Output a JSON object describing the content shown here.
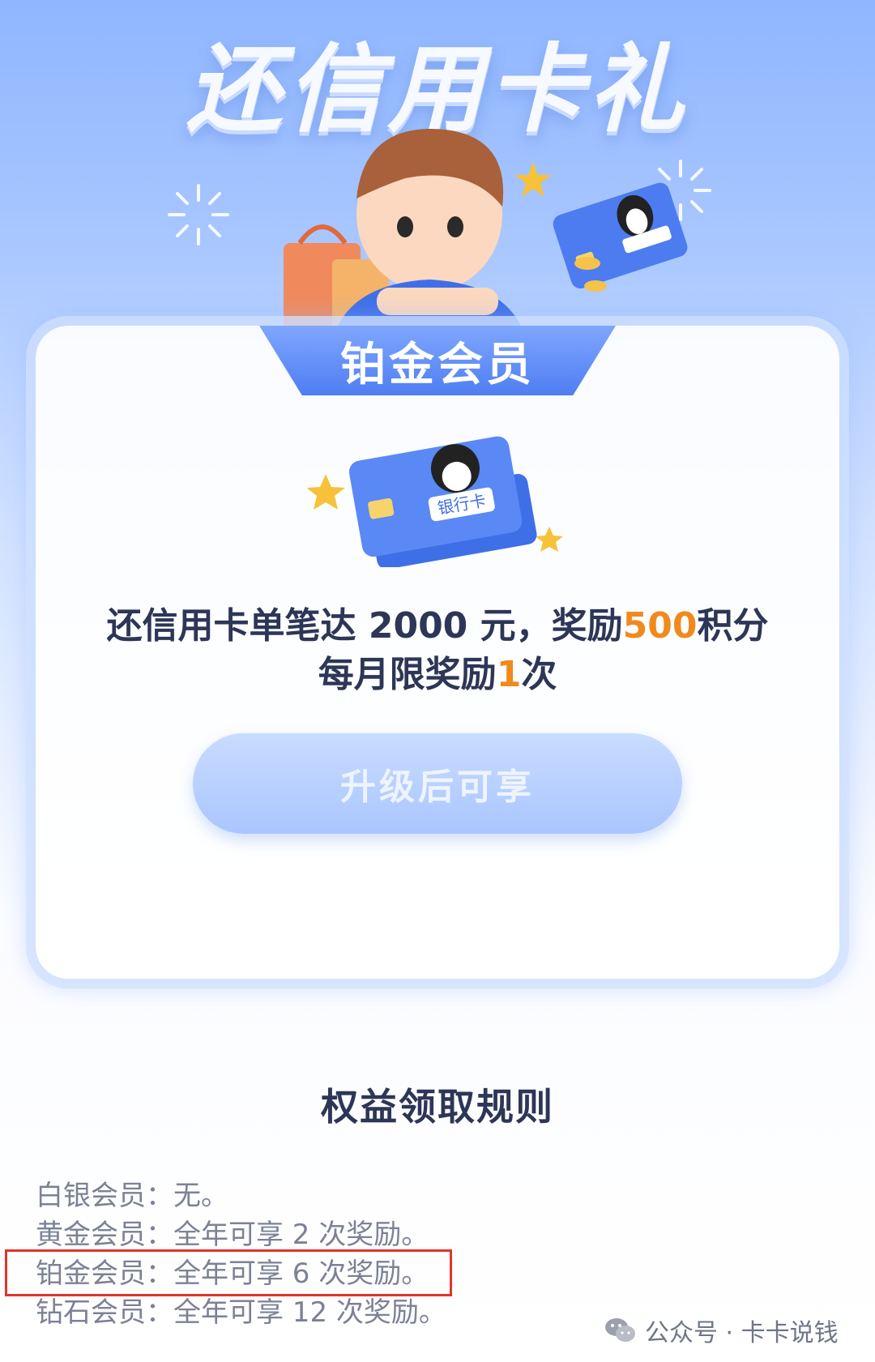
{
  "hero": {
    "title": "还信用卡礼"
  },
  "tier": {
    "label": "铂金会员"
  },
  "card_art": {
    "card_label": "银行卡",
    "icon": "bank-card-penguin-icon"
  },
  "reward": {
    "line1_prefix": "还信用卡单笔达 2000 元，奖励",
    "line1_points": "500",
    "line1_suffix": "积分",
    "line2_prefix": "每月限奖励",
    "line2_count": "1",
    "line2_suffix": "次"
  },
  "upgrade_button": {
    "label": "升级后可享"
  },
  "rules": {
    "title": "权益领取规则",
    "items": [
      {
        "tier": "白银会员：",
        "text": "无。"
      },
      {
        "tier": "黄金会员：",
        "text": "全年可享 2 次奖励。"
      },
      {
        "tier": "铂金会员：",
        "text": "全年可享 6 次奖励。"
      },
      {
        "tier": "钻石会员：",
        "text": "全年可享 12 次奖励。"
      }
    ]
  },
  "watermark": {
    "text": "公众号 · 卡卡说钱"
  },
  "colors": {
    "accent": "#f08a1c",
    "primary": "#4f7ef2",
    "highlight_border": "#e5332b"
  }
}
